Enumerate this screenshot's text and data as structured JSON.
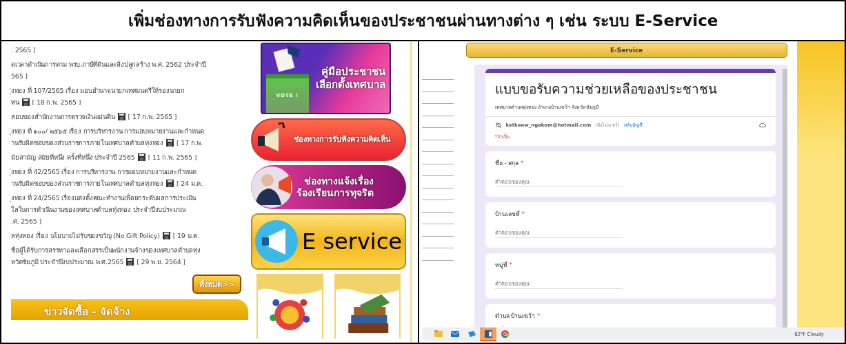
{
  "slide_title": "เพิ่มช่องทางการรับฟังความคิดเห็นของประชาชนผ่านทางต่าง ๆ เช่น ระบบ E-Service",
  "left_page": {
    "news": [
      {
        "lines": [
          {
            "text": ". 2565 ]"
          }
        ]
      },
      {
        "lines": [
          {
            "text": "ดเวลาดำเนินการตาม พรบ.ภาษีที่ดินและสิ่งปลูกสร้าง พ.ศ. 2562 ประจำปี"
          },
          {
            "text": "565 ]"
          }
        ]
      },
      {
        "lines": [
          {
            "text": "ุ่งทอง ที่ 107/2565 เรื่อง มอบอำนาจนายกเทศมนตรีให้รองนายก"
          },
          {
            "text": "ทน",
            "date": "[ 18 ก.พ. 2565 ]"
          }
        ]
      },
      {
        "lines": [
          {
            "text": "สอบของสำนักงานการตรวจเงินแผ่นดิน",
            "date": "[ 17 ก.พ. 2565 ]"
          }
        ]
      },
      {
        "lines": [
          {
            "text": "ุ่งทอง ที่ ๑๐๐/ ๒๕๖๕ เรื่อง การบริหารงาน การมอบหมายงานและกำหนด"
          },
          {
            "text": "านรับผิดชอบของส่วนราชการภายในเทศบาลตำบลทุ่งทอง",
            "date": "[ 17 ก.พ."
          }
        ]
      },
      {
        "lines": [
          {
            "text": "มัยสามัญ สมัยที่หนึ่ง ครั้งที่หนึ่ง ประจำปี 2565",
            "date": "[ 11 ก.พ. 2565 ]"
          }
        ]
      },
      {
        "lines": [
          {
            "text": "ุ่งทอง ที่ 42/2565 เรื่อง การบริหารงาน การมอบหมายงานและกำหนด"
          },
          {
            "text": "านรับผิดชอบของส่วนราชการภายในเทศบาลตำบลทุ่งทอง",
            "date": "[ 24 ม.ค."
          }
        ]
      },
      {
        "lines": [
          {
            "text": "ุ่งทอง ที่ 24/2565 เรื่องแต่งตั้งคณะทำงานเพื่อยกระดับผลการประเมิน"
          },
          {
            "text": "ใสในการดำเนินงานของเทศบาลตำบลทุ่งทอง ประจำปีงบประมาณ"
          },
          {
            "text": ".ศ. 2565 ]"
          }
        ]
      },
      {
        "lines": [
          {
            "text": "ลทุ่งทอง เรื่อง นโยบายไม่รับของขวัญ (No Gift Policy)",
            "date": "[ 19 ม.ค."
          }
        ]
      },
      {
        "lines": [
          {
            "text": "ชื่อผู้ได้รับการสรรหาและเลือกสรรเป็นพนักงานจ้างของเทศบาลตำบลทุ่ง"
          },
          {
            "text": "หวัดชัยภูมิ ประจำปีงบประมาณ พ.ศ.2565",
            "date": "[ 29 พ.ย. 2564 ]"
          }
        ]
      }
    ],
    "more_button": "ทั้งหมด>>",
    "section_header": "ข่าวจัดซื้อ - จัดจ้าง",
    "banners": [
      {
        "kind": "vote",
        "lines": [
          "คู่มือประชาชน",
          "เลือกตั้งเทศบาล"
        ],
        "box_label": "VOTE !"
      },
      {
        "kind": "feedback",
        "lines": [
          "ช่องทางการรับฟังความคิดเห็น"
        ]
      },
      {
        "kind": "complaint",
        "lines": [
          "ช่องทางแจ้งเรื่อง",
          "ร้องเรียนการทุจริต"
        ]
      },
      {
        "kind": "eservice",
        "lines": [
          "E service"
        ]
      }
    ]
  },
  "right_page": {
    "header": "E-Service",
    "form": {
      "title": "แบบขอรับความช่วยเหลือของประชาชน",
      "subtitle": "เทศบาลตำบลทุ่งทอง  อำเภอบ้านเขว้า  จังหวัดชัยภูมิ",
      "account": "ketkaew_ngakom@hotmail.com",
      "share_note": "(ยังไม่แชร์)",
      "switch_link": "สลับบัญชี",
      "required_note": "*จำเป็น",
      "questions": [
        {
          "label": "ชื่อ - สกุล",
          "mark": "*",
          "placeholder": "คำตอบของคุณ"
        },
        {
          "label": "บ้านเลขที่",
          "mark": "*",
          "placeholder": "คำตอบของคุณ"
        },
        {
          "label": "หมู่ที่",
          "mark": "*",
          "placeholder": "คำตอบของคุณ"
        },
        {
          "label": "ตำบล  บ้านเขว้า",
          "mark": "*"
        }
      ]
    },
    "taskbar": {
      "apps": [
        {
          "kind": "folder",
          "selected": false
        },
        {
          "kind": "mail",
          "selected": false
        },
        {
          "kind": "app",
          "selected": false
        },
        {
          "kind": "word",
          "selected": true
        },
        {
          "kind": "chrome",
          "selected": false
        }
      ],
      "weather": "62°F  Cloudy"
    }
  }
}
